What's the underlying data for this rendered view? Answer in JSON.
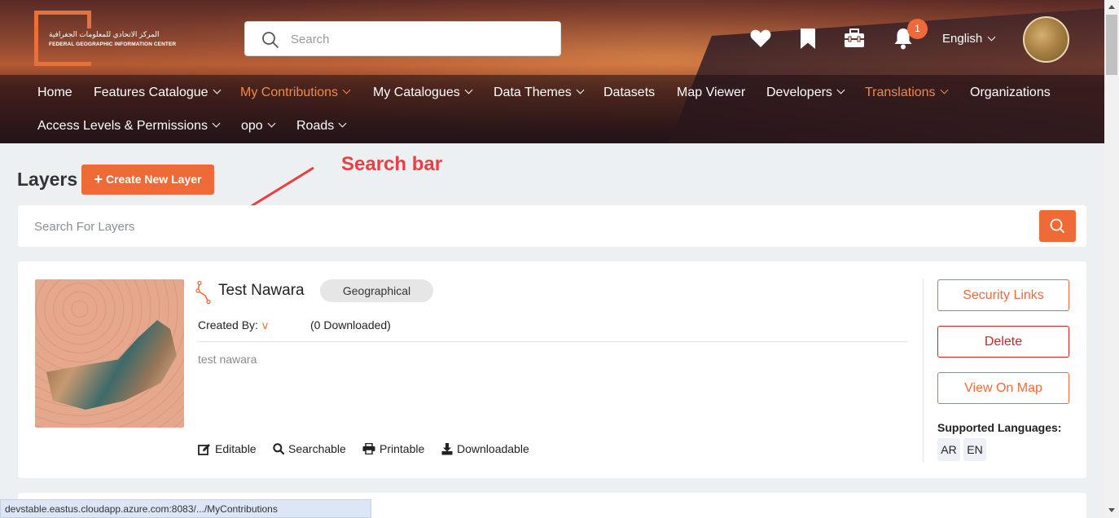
{
  "header": {
    "logo_ar": "المركز الاتحادي للمعلومات الجغرافية",
    "logo_en": "FEDERAL GEOGRAPHIC INFORMATION CENTER",
    "search_placeholder": "Search",
    "notification_count": "1",
    "language": "English"
  },
  "nav": {
    "row1": [
      {
        "label": "Home",
        "dropdown": false
      },
      {
        "label": "Features Catalogue",
        "dropdown": true
      },
      {
        "label": "My Contributions",
        "dropdown": true,
        "active": true
      },
      {
        "label": "My Catalogues",
        "dropdown": true
      },
      {
        "label": "Data Themes",
        "dropdown": true
      },
      {
        "label": "Datasets",
        "dropdown": false
      },
      {
        "label": "Map Viewer",
        "dropdown": false
      },
      {
        "label": "Developers",
        "dropdown": true
      },
      {
        "label": "Translations",
        "dropdown": true,
        "active": true
      },
      {
        "label": "Organizations",
        "dropdown": false
      }
    ],
    "row2": [
      {
        "label": "Access Levels & Permissions",
        "dropdown": true
      },
      {
        "label": "opo",
        "dropdown": true
      },
      {
        "label": "Roads",
        "dropdown": true
      }
    ]
  },
  "page": {
    "title": "Layers",
    "create_button": "Create New Layer",
    "annotation": "Search bar",
    "search_placeholder": "Search For Layers"
  },
  "layer": {
    "name": "Test Nawara",
    "tag": "Geographical",
    "created_by_label": "Created By:",
    "created_by": "v",
    "downloads": "(0 Downloaded)",
    "description": "test nawara",
    "features": [
      "Editable",
      "Searchable",
      "Printable",
      "Downloadable"
    ],
    "actions": {
      "security": "Security Links",
      "delete": "Delete",
      "view_map": "View On Map"
    },
    "supported_label": "Supported Languages:",
    "languages": [
      "AR",
      "EN"
    ]
  },
  "status_bar": {
    "url": "devstable.eastus.cloudapp.azure.com:8083/.../MyContributions"
  },
  "colors": {
    "accent": "#ee6b37",
    "danger": "#d32020",
    "annotation": "#ec3e3e"
  }
}
